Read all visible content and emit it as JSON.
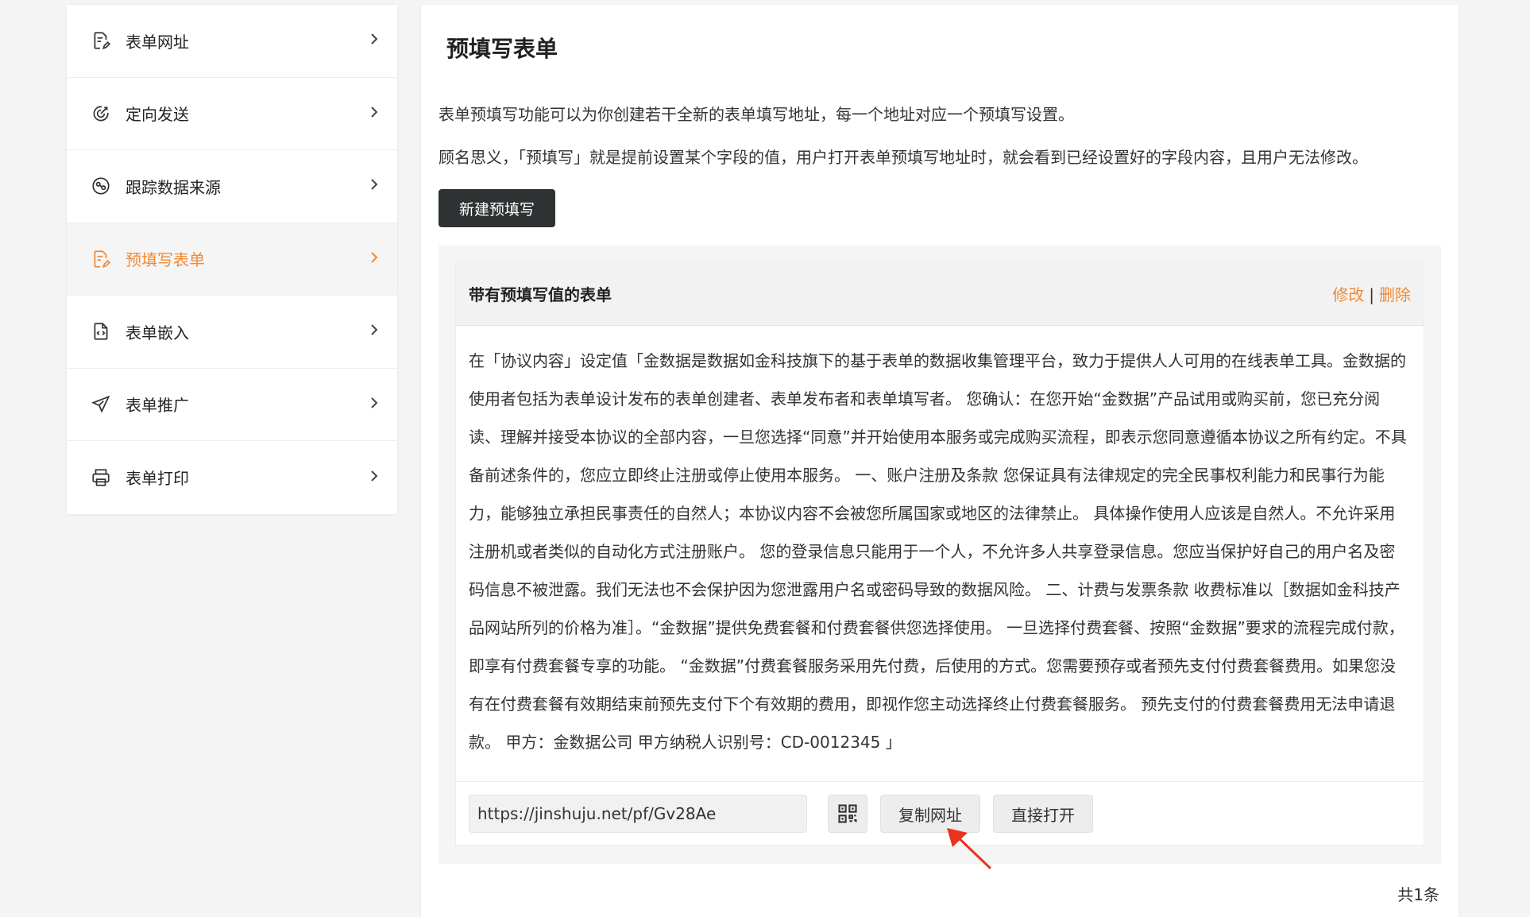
{
  "sidebar": {
    "items": [
      {
        "label": "表单网址",
        "icon": "form-edit-icon"
      },
      {
        "label": "定向发送",
        "icon": "target-icon"
      },
      {
        "label": "跟踪数据来源",
        "icon": "chart-source-icon"
      },
      {
        "label": "预填写表单",
        "icon": "form-edit-icon",
        "active": true
      },
      {
        "label": "表单嵌入",
        "icon": "code-file-icon"
      },
      {
        "label": "表单推广",
        "icon": "paper-plane-icon"
      },
      {
        "label": "表单打印",
        "icon": "printer-icon"
      }
    ]
  },
  "main": {
    "title": "预填写表单",
    "desc1": "表单预填写功能可以为你创建若干全新的表单填写地址，每一个地址对应一个预填写设置。",
    "desc2": "顾名思义，「预填写」就是提前设置某个字段的值，用户打开表单预填写地址时，就会看到已经设置好的字段内容，且用户无法修改。",
    "new_button": "新建预填写",
    "card": {
      "title": "带有预填写值的表单",
      "edit": "修改",
      "separator": "|",
      "delete": "删除",
      "body": "在「协议内容」设定值「金数据是数据如金科技旗下的基于表单的数据收集管理平台，致力于提供人人可用的在线表单工具。金数据的使用者包括为表单设计发布的表单创建者、表单发布者和表单填写者。 您确认：在您开始“金数据”产品试用或购买前，您已充分阅读、理解并接受本协议的全部内容，一旦您选择“同意”并开始使用本服务或完成购买流程，即表示您同意遵循本协议之所有约定。不具备前述条件的，您应立即终止注册或停止使用本服务。 一、账户注册及条款 您保证具有法律规定的完全民事权利能力和民事行为能力，能够独立承担民事责任的自然人；本协议内容不会被您所属国家或地区的法律禁止。 具体操作使用人应该是自然人。不允许采用注册机或者类似的自动化方式注册账户。 您的登录信息只能用于一个人，不允许多人共享登录信息。您应当保护好自己的用户名及密码信息不被泄露。我们无法也不会保护因为您泄露用户名或密码导致的数据风险。 二、计费与发票条款 收费标准以［数据如金科技产品网站所列的价格为准］。“金数据”提供免费套餐和付费套餐供您选择使用。 一旦选择付费套餐、按照“金数据”要求的流程完成付款，即享有付费套餐专享的功能。 “金数据”付费套餐服务采用先付费，后使用的方式。您需要预存或者预先支付付费套餐费用。如果您没有在付费套餐有效期结束前预先支付下个有效期的费用，即视作您主动选择终止付费套餐服务。 预先支付的付费套餐费用无法申请退款。 甲方：金数据公司 甲方纳税人识别号：CD-0012345 」",
      "url": "https://jinshuju.net/pf/Gv28Ae",
      "copy_button": "复制网址",
      "open_button": "直接打开"
    },
    "total": "共1条"
  },
  "colors": {
    "accent": "#f08a35",
    "dark_button": "#2f3233",
    "annotation_arrow": "#e8341c"
  }
}
